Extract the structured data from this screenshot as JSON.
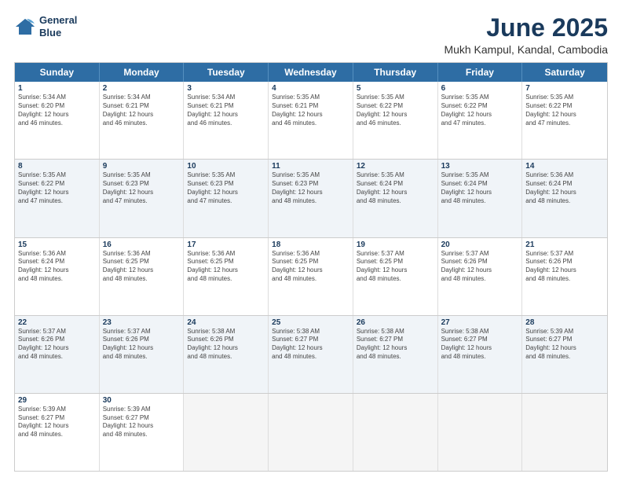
{
  "app": {
    "logo_line1": "General",
    "logo_line2": "Blue"
  },
  "header": {
    "title": "June 2025",
    "subtitle": "Mukh Kampul, Kandal, Cambodia"
  },
  "calendar": {
    "days_of_week": [
      "Sunday",
      "Monday",
      "Tuesday",
      "Wednesday",
      "Thursday",
      "Friday",
      "Saturday"
    ],
    "rows": [
      [
        {
          "day": "",
          "info": ""
        },
        {
          "day": "2",
          "info": "Sunrise: 5:34 AM\nSunset: 6:21 PM\nDaylight: 12 hours\nand 46 minutes."
        },
        {
          "day": "3",
          "info": "Sunrise: 5:34 AM\nSunset: 6:21 PM\nDaylight: 12 hours\nand 46 minutes."
        },
        {
          "day": "4",
          "info": "Sunrise: 5:35 AM\nSunset: 6:21 PM\nDaylight: 12 hours\nand 46 minutes."
        },
        {
          "day": "5",
          "info": "Sunrise: 5:35 AM\nSunset: 6:22 PM\nDaylight: 12 hours\nand 46 minutes."
        },
        {
          "day": "6",
          "info": "Sunrise: 5:35 AM\nSunset: 6:22 PM\nDaylight: 12 hours\nand 47 minutes."
        },
        {
          "day": "7",
          "info": "Sunrise: 5:35 AM\nSunset: 6:22 PM\nDaylight: 12 hours\nand 47 minutes."
        }
      ],
      [
        {
          "day": "8",
          "info": "Sunrise: 5:35 AM\nSunset: 6:22 PM\nDaylight: 12 hours\nand 47 minutes."
        },
        {
          "day": "9",
          "info": "Sunrise: 5:35 AM\nSunset: 6:23 PM\nDaylight: 12 hours\nand 47 minutes."
        },
        {
          "day": "10",
          "info": "Sunrise: 5:35 AM\nSunset: 6:23 PM\nDaylight: 12 hours\nand 47 minutes."
        },
        {
          "day": "11",
          "info": "Sunrise: 5:35 AM\nSunset: 6:23 PM\nDaylight: 12 hours\nand 48 minutes."
        },
        {
          "day": "12",
          "info": "Sunrise: 5:35 AM\nSunset: 6:24 PM\nDaylight: 12 hours\nand 48 minutes."
        },
        {
          "day": "13",
          "info": "Sunrise: 5:35 AM\nSunset: 6:24 PM\nDaylight: 12 hours\nand 48 minutes."
        },
        {
          "day": "14",
          "info": "Sunrise: 5:36 AM\nSunset: 6:24 PM\nDaylight: 12 hours\nand 48 minutes."
        }
      ],
      [
        {
          "day": "15",
          "info": "Sunrise: 5:36 AM\nSunset: 6:24 PM\nDaylight: 12 hours\nand 48 minutes."
        },
        {
          "day": "16",
          "info": "Sunrise: 5:36 AM\nSunset: 6:25 PM\nDaylight: 12 hours\nand 48 minutes."
        },
        {
          "day": "17",
          "info": "Sunrise: 5:36 AM\nSunset: 6:25 PM\nDaylight: 12 hours\nand 48 minutes."
        },
        {
          "day": "18",
          "info": "Sunrise: 5:36 AM\nSunset: 6:25 PM\nDaylight: 12 hours\nand 48 minutes."
        },
        {
          "day": "19",
          "info": "Sunrise: 5:37 AM\nSunset: 6:25 PM\nDaylight: 12 hours\nand 48 minutes."
        },
        {
          "day": "20",
          "info": "Sunrise: 5:37 AM\nSunset: 6:26 PM\nDaylight: 12 hours\nand 48 minutes."
        },
        {
          "day": "21",
          "info": "Sunrise: 5:37 AM\nSunset: 6:26 PM\nDaylight: 12 hours\nand 48 minutes."
        }
      ],
      [
        {
          "day": "22",
          "info": "Sunrise: 5:37 AM\nSunset: 6:26 PM\nDaylight: 12 hours\nand 48 minutes."
        },
        {
          "day": "23",
          "info": "Sunrise: 5:37 AM\nSunset: 6:26 PM\nDaylight: 12 hours\nand 48 minutes."
        },
        {
          "day": "24",
          "info": "Sunrise: 5:38 AM\nSunset: 6:26 PM\nDaylight: 12 hours\nand 48 minutes."
        },
        {
          "day": "25",
          "info": "Sunrise: 5:38 AM\nSunset: 6:27 PM\nDaylight: 12 hours\nand 48 minutes."
        },
        {
          "day": "26",
          "info": "Sunrise: 5:38 AM\nSunset: 6:27 PM\nDaylight: 12 hours\nand 48 minutes."
        },
        {
          "day": "27",
          "info": "Sunrise: 5:38 AM\nSunset: 6:27 PM\nDaylight: 12 hours\nand 48 minutes."
        },
        {
          "day": "28",
          "info": "Sunrise: 5:39 AM\nSunset: 6:27 PM\nDaylight: 12 hours\nand 48 minutes."
        }
      ],
      [
        {
          "day": "29",
          "info": "Sunrise: 5:39 AM\nSunset: 6:27 PM\nDaylight: 12 hours\nand 48 minutes."
        },
        {
          "day": "30",
          "info": "Sunrise: 5:39 AM\nSunset: 6:27 PM\nDaylight: 12 hours\nand 48 minutes."
        },
        {
          "day": "",
          "info": ""
        },
        {
          "day": "",
          "info": ""
        },
        {
          "day": "",
          "info": ""
        },
        {
          "day": "",
          "info": ""
        },
        {
          "day": "",
          "info": ""
        }
      ]
    ],
    "row1_day1": {
      "day": "1",
      "info": "Sunrise: 5:34 AM\nSunset: 6:20 PM\nDaylight: 12 hours\nand 46 minutes."
    }
  }
}
